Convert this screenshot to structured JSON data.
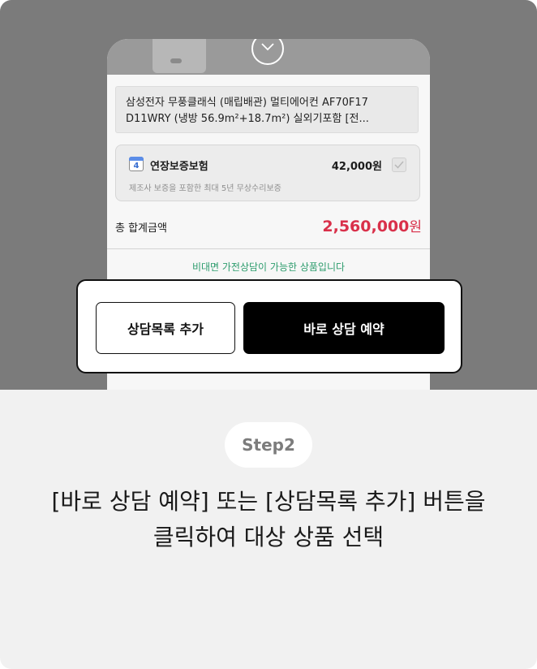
{
  "product": {
    "name_line1": "삼성전자 무풍클래식 (매립배관) 멀티에어컨 AF70F17",
    "name_line2": "D11WRY (냉방 56.9m²+18.7m²) 실외기포함 [전..."
  },
  "warranty": {
    "calendar_day": "4",
    "title": "연장보증보험",
    "price": "42,000원",
    "description": "제조사 보증을 포함한 최대 5년 무상수리보증"
  },
  "total": {
    "label": "총 합계금액",
    "amount": "2,560,000",
    "currency": "원"
  },
  "notice": "비대면 가전상담이 가능한 상품입니다",
  "actions": {
    "add_to_list": "상담목록 추가",
    "book_now": "바로 상담 예약"
  },
  "step": "Step2",
  "instruction": {
    "line1": "[바로 상담 예약] 또는 [상담목록 추가] 버튼을",
    "line2": "클릭하여 대상 상품 선택"
  },
  "colors": {
    "accent_price": "#d9304a",
    "notice_green": "#2d9c6d",
    "primary_button": "#000000"
  }
}
